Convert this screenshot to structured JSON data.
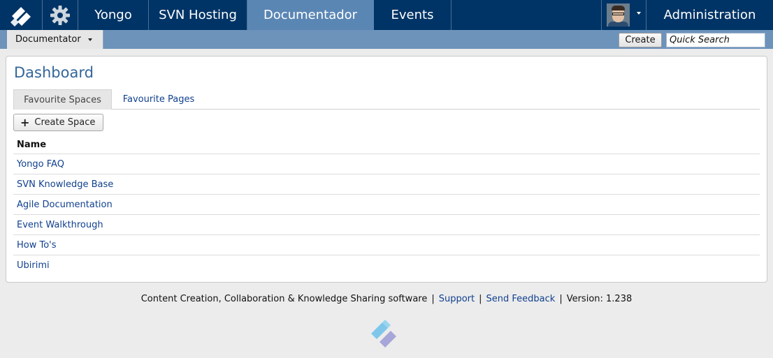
{
  "nav": {
    "tabs": [
      {
        "label": "Yongo"
      },
      {
        "label": "SVN Hosting"
      },
      {
        "label": "Documentador",
        "active": true
      },
      {
        "label": "Events"
      }
    ],
    "admin_label": "Administration",
    "colors": {
      "bar": "#003466",
      "active": "#5a86b4",
      "subbar": "#6d93bb"
    }
  },
  "subbar": {
    "space_dropdown": "Documentator",
    "create_label": "Create",
    "search_value": "Quick Search"
  },
  "dashboard": {
    "title": "Dashboard",
    "tabs": [
      {
        "label": "Favourite Spaces",
        "active": true
      },
      {
        "label": "Favourite Pages"
      }
    ],
    "create_space_label": "Create Space",
    "table": {
      "header": "Name",
      "rows": [
        "Yongo FAQ",
        "SVN Knowledge Base",
        "Agile Documentation",
        "Event Walkthrough",
        "How To's",
        "Ubirimi"
      ]
    }
  },
  "footer": {
    "text": "Content Creation, Collaboration & Knowledge Sharing software",
    "support": "Support",
    "feedback": "Send Feedback",
    "version": "Version: 1.238"
  },
  "icons": [
    "logo-icon",
    "gear-icon",
    "user-avatar",
    "chevron-down-icon",
    "plus-icon"
  ]
}
